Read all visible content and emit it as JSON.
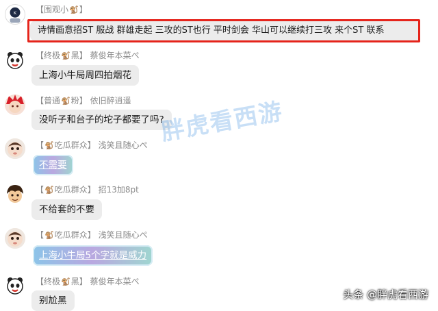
{
  "messages": [
    {
      "prefix": "【围观小",
      "suffix": "】",
      "icon": "🐒",
      "name": "",
      "text": "诗情画意招ST 服战 群雄走起  三攻的ST也行  平时剑会 华山可以继续打三攻    来个ST 联系",
      "style": "normal",
      "avatar": "white-k"
    },
    {
      "prefix": "【终极",
      "suffix": "黑】",
      "icon": "🐒",
      "name": "蔡俊年本菜ぺ",
      "text": "上海小牛局周四拍烟花",
      "style": "normal",
      "avatar": "panda"
    },
    {
      "prefix": "【普通",
      "suffix": "粉】",
      "icon": "🐒",
      "name": "依旧醉逍遥",
      "text": "没听子和台子的坨子都要了吗?",
      "style": "normal",
      "avatar": "red-hair"
    },
    {
      "prefix": "【",
      "suffix": "吃瓜群众】",
      "icon": "🐒",
      "name": "浅笑且随心ぺ",
      "text": "不需要",
      "style": "fancy",
      "avatar": "baby"
    },
    {
      "prefix": "【",
      "suffix": "吃瓜群众】",
      "icon": "🐒",
      "name": "招13加8pt",
      "text": "不给套的不要",
      "style": "normal",
      "avatar": "cartoon-boy"
    },
    {
      "prefix": "【",
      "suffix": "吃瓜群众】",
      "icon": "🐒",
      "name": "浅笑且随心ぺ",
      "text": "上海小牛局5个字就是威力",
      "style": "fancy",
      "avatar": "baby"
    },
    {
      "prefix": "【终极",
      "suffix": "黑】",
      "icon": "🐒",
      "name": "蔡俊年本菜ぺ",
      "text": "别尬黑",
      "style": "normal",
      "avatar": "panda"
    }
  ],
  "watermark": "胖虎看西游",
  "source_tag": "头条 @胖虎看西游",
  "colors": {
    "highlight": "#e5241b",
    "bubble": "#ececec",
    "meta": "#8a8a8a"
  }
}
